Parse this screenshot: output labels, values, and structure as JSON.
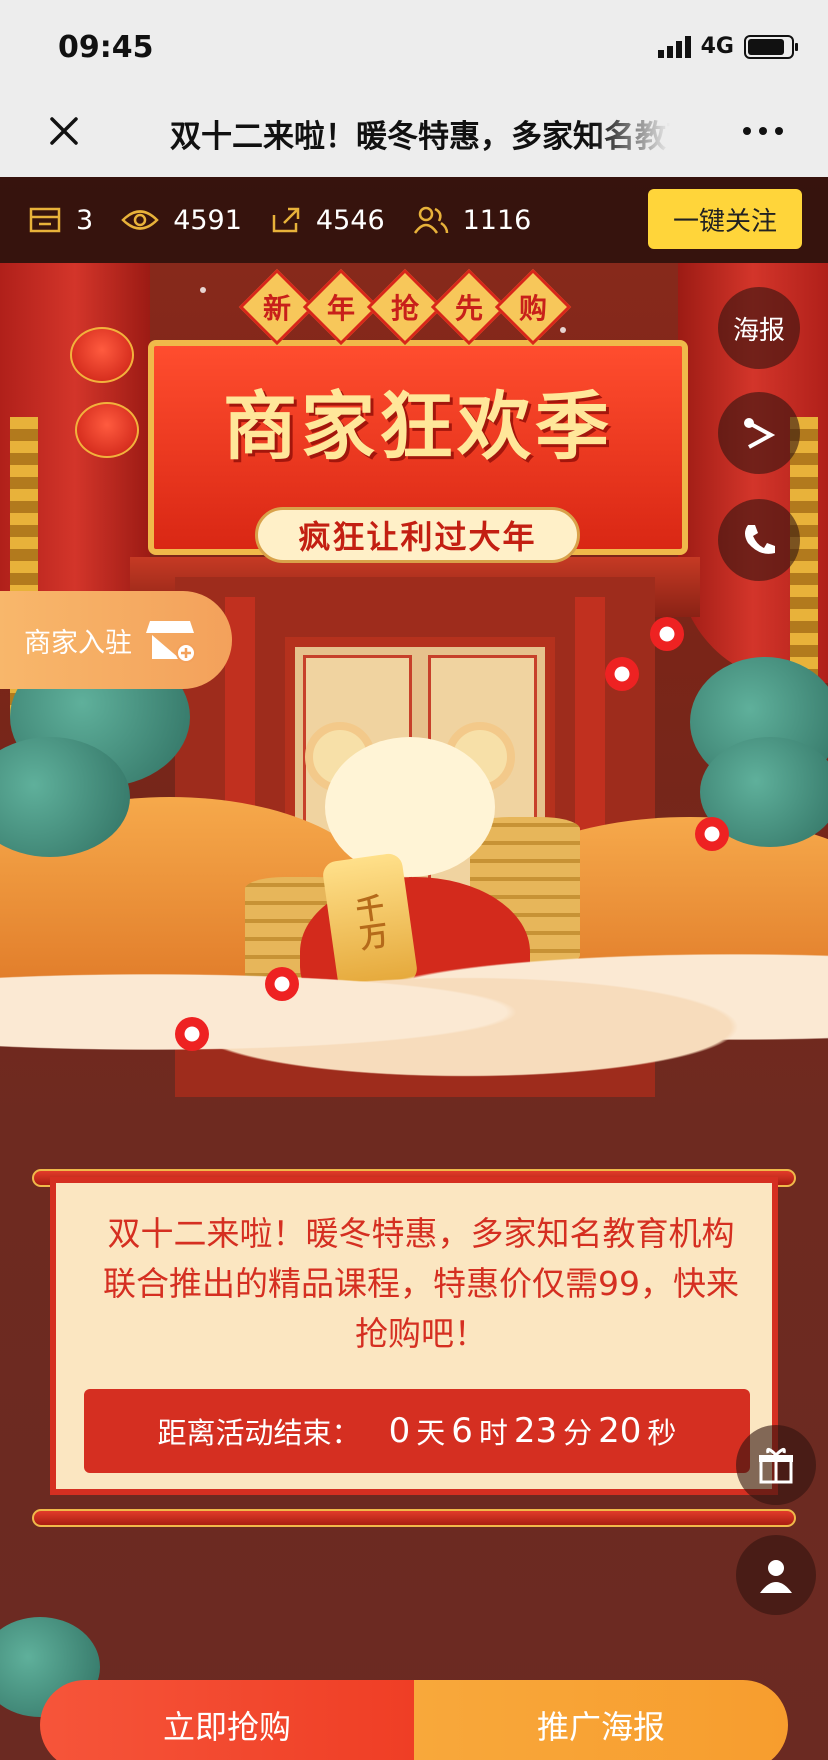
{
  "status": {
    "time": "09:45",
    "network": "4G"
  },
  "nav": {
    "title": "双十二来啦！暖冬特惠，多家知名教育机构联合推出的精品课程"
  },
  "stats": {
    "products": "3",
    "views": "4591",
    "shares": "4546",
    "users": "1116",
    "follow_label": "一键关注"
  },
  "banner": {
    "tags": [
      "新",
      "年",
      "抢",
      "先",
      "购"
    ],
    "main": "商家狂欢季",
    "sub": "疯狂让利过大年",
    "gold_bar_text": "千万"
  },
  "side": {
    "poster_label": "海报",
    "merchant_label": "商家入驻"
  },
  "card": {
    "description": "双十二来啦！暖冬特惠，多家知名教育机构联合推出的精品课程，特惠价仅需99，快来抢购吧！",
    "countdown_prefix": "距离活动结束：",
    "days": "0",
    "days_unit": "天",
    "hours": "6",
    "hours_unit": "时",
    "minutes": "23",
    "minutes_unit": "分",
    "seconds": "20",
    "seconds_unit": "秒"
  },
  "bottom": {
    "buy_label": "立即抢购",
    "poster_label": "推广海报"
  },
  "colors": {
    "accent_red": "#d52f21",
    "follow_yellow": "#ffd53a",
    "buy_orange_red": "#ef3e25",
    "poster_orange": "#f79d2e"
  }
}
